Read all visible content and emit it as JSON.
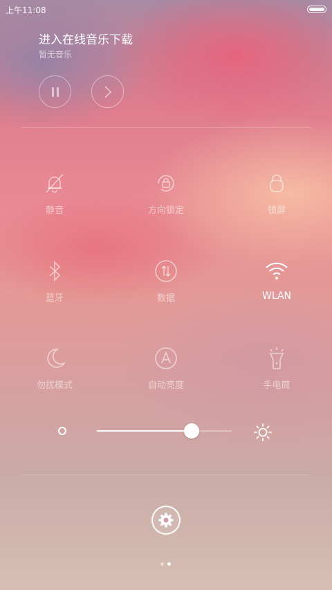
{
  "status_bar": {
    "time": "上午11:08"
  },
  "music": {
    "title": "进入在线音乐下载",
    "subtitle": "暂无音乐"
  },
  "toggles": [
    {
      "label": "静音",
      "icon": "bell-off-icon",
      "active": false
    },
    {
      "label": "方向锁定",
      "icon": "rotation-lock-icon",
      "active": false
    },
    {
      "label": "锁屏",
      "icon": "lock-icon",
      "active": false
    },
    {
      "label": "蓝牙",
      "icon": "bluetooth-icon",
      "active": false
    },
    {
      "label": "数据",
      "icon": "mobile-data-icon",
      "active": false
    },
    {
      "label": "WLAN",
      "icon": "wifi-icon",
      "active": true
    },
    {
      "label": "勿扰模式",
      "icon": "moon-icon",
      "active": false
    },
    {
      "label": "自动亮度",
      "icon": "auto-brightness-icon",
      "active": false
    },
    {
      "label": "手电筒",
      "icon": "flashlight-icon",
      "active": false
    }
  ],
  "brightness": {
    "level": 0.7
  },
  "pager": {
    "pages": 2,
    "current": 2
  }
}
